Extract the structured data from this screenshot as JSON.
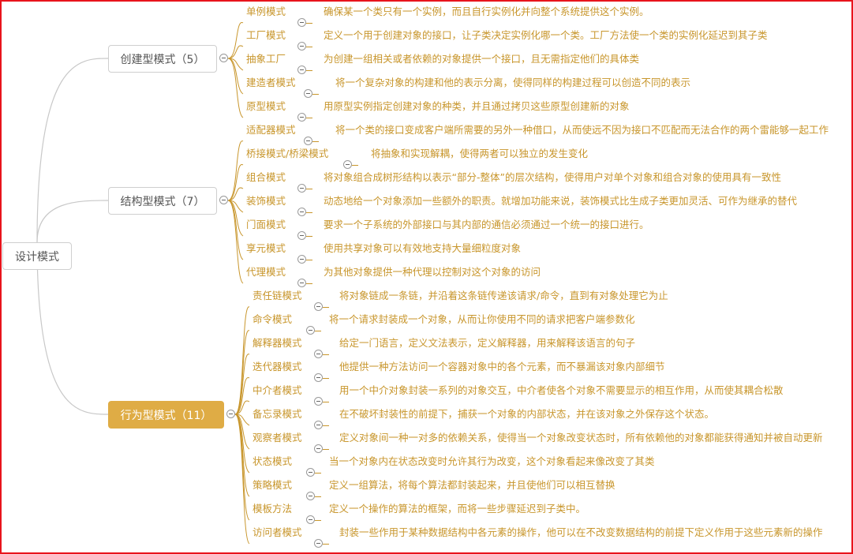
{
  "root": {
    "label": "设计模式"
  },
  "colors": {
    "accent": "#dfac45",
    "text": "#c8962c",
    "border": "#e8141c"
  },
  "categories": [
    {
      "label": "创建型模式（5）",
      "items": [
        {
          "name": "单例模式",
          "desc": "确保某一个类只有一个实例，而且自行实例化并向整个系统提供这个实例。"
        },
        {
          "name": "工厂模式",
          "desc": "定义一个用于创建对象的接口，让子类决定实例化哪一个类。工厂方法使一个类的实例化延迟到其子类"
        },
        {
          "name": "抽象工厂",
          "desc": "为创建一组相关或者依赖的对象提供一个接口，且无需指定他们的具体类"
        },
        {
          "name": "建造者模式",
          "desc": "将一个复杂对象的构建和他的表示分离，使得同样的构建过程可以创造不同的表示"
        },
        {
          "name": "原型模式",
          "desc": "用原型实例指定创建对象的种类，并且通过拷贝这些原型创建新的对象"
        }
      ]
    },
    {
      "label": "结构型模式（7）",
      "items": [
        {
          "name": "适配器模式",
          "desc": "将一个类的接口变成客户端所需要的另外一种借口，从而使远不因为接口不匹配而无法合作的两个雷能够一起工作"
        },
        {
          "name": "桥接模式/桥梁模式",
          "desc": "将抽象和实现解耦，使得两者可以独立的发生变化"
        },
        {
          "name": "组合模式",
          "desc": "将对象组合成树形结构以表示“部分-整体”的层次结构，使得用户对单个对象和组合对象的使用具有一致性"
        },
        {
          "name": "装饰模式",
          "desc": "动态地给一个对象添加一些额外的职责。就增加功能来说，装饰模式比生成子类更加灵活、可作为继承的替代"
        },
        {
          "name": "门面模式",
          "desc": "要求一个子系统的外部接口与其内部的通信必须通过一个统一的接口进行。"
        },
        {
          "name": "享元模式",
          "desc": "使用共享对象可以有效地支持大量细粒度对象"
        },
        {
          "name": "代理模式",
          "desc": "为其他对象提供一种代理以控制对这个对象的访问"
        }
      ]
    },
    {
      "label": "行为型模式（11）",
      "items": [
        {
          "name": "责任链模式",
          "desc": "将对象链成一条链，并沿着这条链传递该请求/命令，直到有对象处理它为止"
        },
        {
          "name": "命令模式",
          "desc": "将一个请求封装成一个对象，从而让你使用不同的请求把客户端参数化"
        },
        {
          "name": "解释器模式",
          "desc": "给定一门语言，定义文法表示，定义解释器，用来解释该语言的句子"
        },
        {
          "name": "迭代器模式",
          "desc": "他提供一种方法访问一个容器对象中的各个元素，而不暴漏该对象内部细节"
        },
        {
          "name": "中介者模式",
          "desc": "用一个中介对象封装一系列的对象交互，中介者使各个对象不需要显示的相互作用，从而使其耦合松散"
        },
        {
          "name": "备忘录模式",
          "desc": "在不破坏封装性的前提下，捕获一个对象的内部状态，并在该对象之外保存这个状态。"
        },
        {
          "name": "观察者模式",
          "desc": "定义对象间一种一对多的依赖关系，使得当一个对象改变状态时，所有依赖他的对象都能获得通知并被自动更新"
        },
        {
          "name": "状态模式",
          "desc": "当一个对象内在状态改变时允许其行为改变，这个对象看起来像改变了其类"
        },
        {
          "name": "策略模式",
          "desc": "定义一组算法，将每个算法都封装起来，并且使他们可以相互替换"
        },
        {
          "name": "模板方法",
          "desc": "定义一个操作的算法的框架，而将一些步骤延迟到子类中。"
        },
        {
          "name": "访问者模式",
          "desc": "封装一些作用于某种数据结构中各元素的操作，他可以在不改变数据结构的前提下定义作用于这些元素新的操作"
        }
      ]
    }
  ]
}
